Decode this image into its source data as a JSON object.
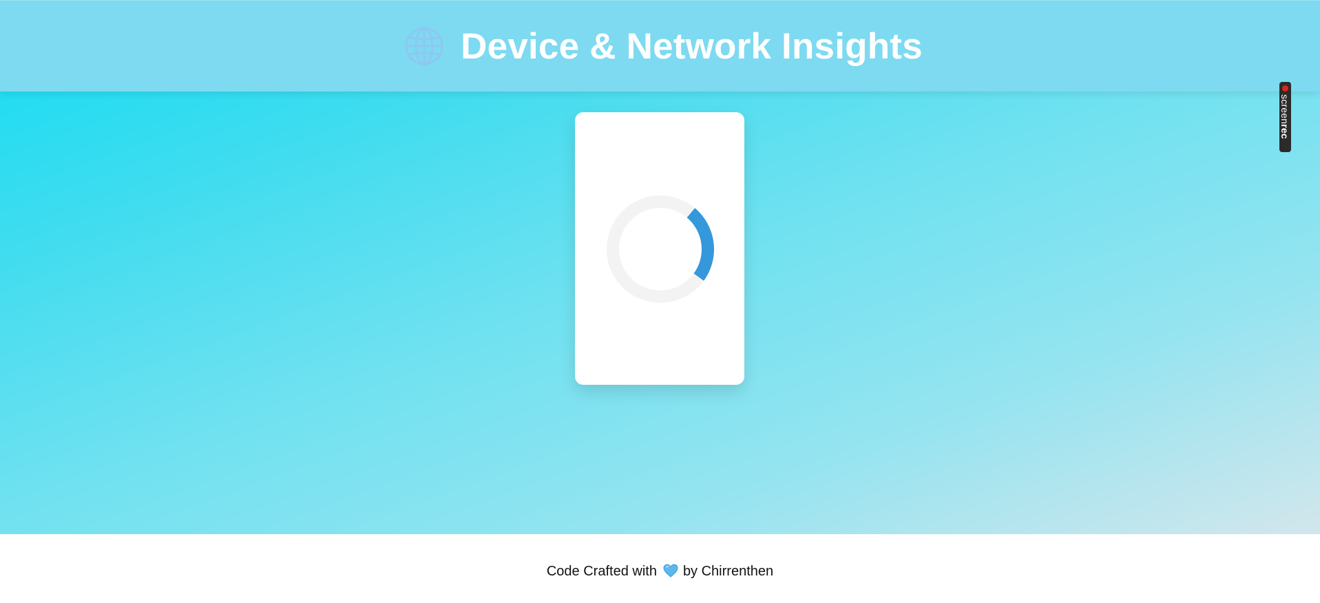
{
  "header": {
    "title": "Device & Network Insights",
    "icon": "globe-icon"
  },
  "card": {
    "loading_icon": "loading-spinner",
    "spinner_track_color": "#f3f3f3",
    "spinner_arc_color": "#3498db"
  },
  "badge": {
    "text_light": "screen",
    "text_bold": "rec"
  },
  "footer": {
    "prefix": "Code Crafted with",
    "heart_icon": "heart-icon",
    "suffix": "by Chirrenthen"
  },
  "colors": {
    "header_bg": "#7ddaf0",
    "gradient_start": "#12dcf3",
    "gradient_end": "#d2e6ec",
    "heart": "#5bb8ec"
  }
}
